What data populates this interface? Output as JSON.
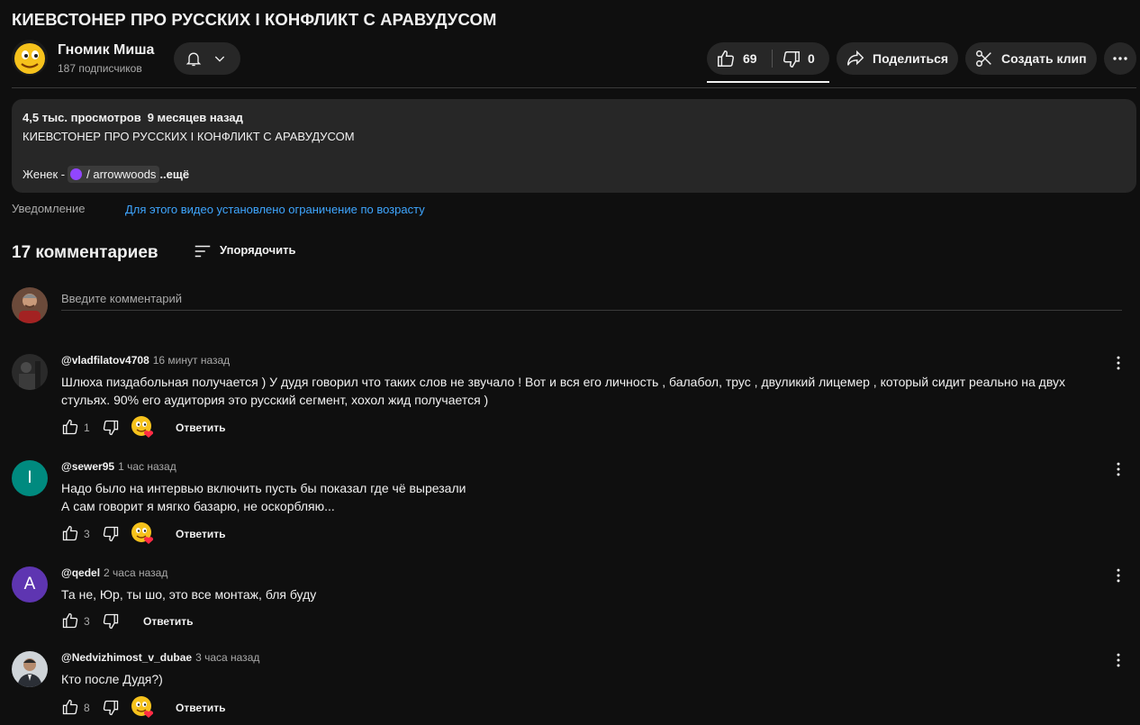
{
  "video": {
    "title": "КИЕВСТОНЕР ПРО РУССКИХ І КОНФЛИКТ С АРАВУДУСОМ"
  },
  "channel": {
    "name": "Гномик Миша",
    "subscribers": "187 подписчиков"
  },
  "actions": {
    "likes": "69",
    "dislikes": "0",
    "share_label": "Поделиться",
    "clip_label": "Создать клип"
  },
  "description": {
    "views": "4,5 тыс. просмотров",
    "date": "9 месяцев назад",
    "line1": "КИЕВСТОНЕР ПРО РУССКИХ І КОНФЛИКТ С АРАВУДУСОМ",
    "line3_prefix": "Женек -",
    "link_text": "/ arrowwoods",
    "more_label": "..ещё"
  },
  "notice": {
    "label": "Уведомление",
    "link": "Для этого видео установлено ограничение по возрасту"
  },
  "comments_section": {
    "count_label": "17 комментариев",
    "sort_label": "Упорядочить",
    "input_placeholder": "Введите комментарий"
  },
  "comments": [
    {
      "author": "@vladfilatov4708",
      "time": "16 минут назад",
      "text": "Шлюха пиздабольная получается ) У дудя говорил что таких слов не звучало ! Вот и вся его личность , балабол, трус , двуликий лицемер , который сидит реально на двух стульях. 90% его аудитория это русский сегмент, хохол жид получается )",
      "likes": "1",
      "reply_label": "Ответить",
      "avatar_letter": ""
    },
    {
      "author": "@sewer95",
      "time": "1 час назад",
      "text": "Надо было на интервью включить пусть бы показал где чё вырезали\nА сам говорит я мягко базарю, не оскорбляю...",
      "likes": "3",
      "reply_label": "Ответить",
      "avatar_letter": "I"
    },
    {
      "author": "@qedel",
      "time": "2 часа назад",
      "text": "Та не, Юр, ты шо, это все монтаж, бля буду",
      "likes": "3",
      "reply_label": "Ответить",
      "avatar_letter": "A"
    },
    {
      "author": "@Nedvizhimost_v_dubae",
      "time": "3 часа назад",
      "text": "Кто после Дудя?)",
      "likes": "8",
      "reply_label": "Ответить",
      "avatar_letter": ""
    }
  ],
  "colors": {
    "background": "#0f0f0f",
    "surface": "#272727",
    "link": "#3ea6ff",
    "avatar_sewer95": "#008a7f",
    "avatar_qedel": "#5e35b1",
    "twitch": "#9146ff"
  }
}
